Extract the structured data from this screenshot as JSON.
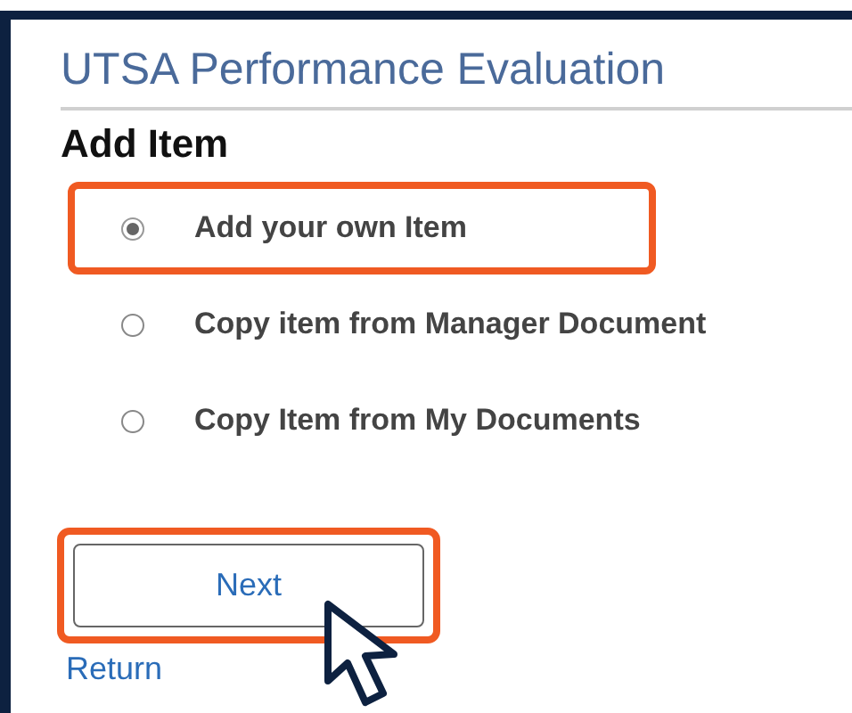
{
  "header": {
    "title": "UTSA Performance Evaluation"
  },
  "section": {
    "heading": "Add Item"
  },
  "options": [
    {
      "label": "Add your own Item",
      "selected": true,
      "highlighted": true
    },
    {
      "label": "Copy item from Manager Document",
      "selected": false,
      "highlighted": false
    },
    {
      "label": "Copy Item from My Documents",
      "selected": false,
      "highlighted": false
    }
  ],
  "next_button": {
    "label": "Next",
    "highlighted": true
  },
  "return_link": {
    "label": "Return"
  }
}
